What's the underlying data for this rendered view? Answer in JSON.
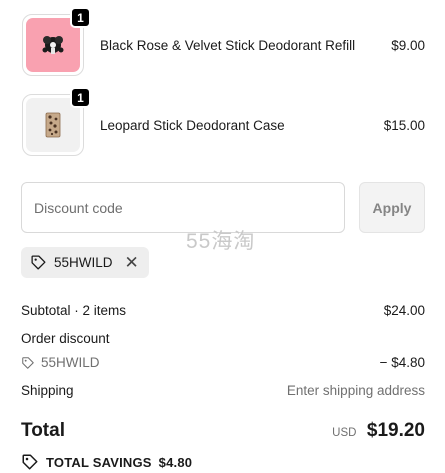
{
  "line_items": [
    {
      "name": "Black Rose & Velvet Stick Deodorant Refill",
      "price": "$9.00",
      "quantity": "1",
      "image_bg": "#f9a1b0",
      "image": "black-rose-product-photo"
    },
    {
      "name": "Leopard Stick Deodorant Case",
      "price": "$15.00",
      "quantity": "1",
      "image_bg": "#f1f1f1",
      "image": "leopard-case-product-photo"
    }
  ],
  "discount": {
    "placeholder": "Discount code",
    "apply_label": "Apply",
    "applied_code": "55HWILD",
    "tag_icon": "tag-icon",
    "remove_icon": "close-icon"
  },
  "watermark": "55海淘",
  "summary": {
    "subtotal_label": "Subtotal · 2 items",
    "subtotal_value": "$24.00",
    "order_discount_label": "Order discount",
    "discount_code": "55HWILD",
    "discount_value": "− $4.80",
    "shipping_label": "Shipping",
    "shipping_value": "Enter shipping address"
  },
  "total": {
    "label": "Total",
    "currency": "USD",
    "amount": "$19.20"
  },
  "savings": {
    "label": "TOTAL SAVINGS",
    "amount": "$4.80"
  }
}
